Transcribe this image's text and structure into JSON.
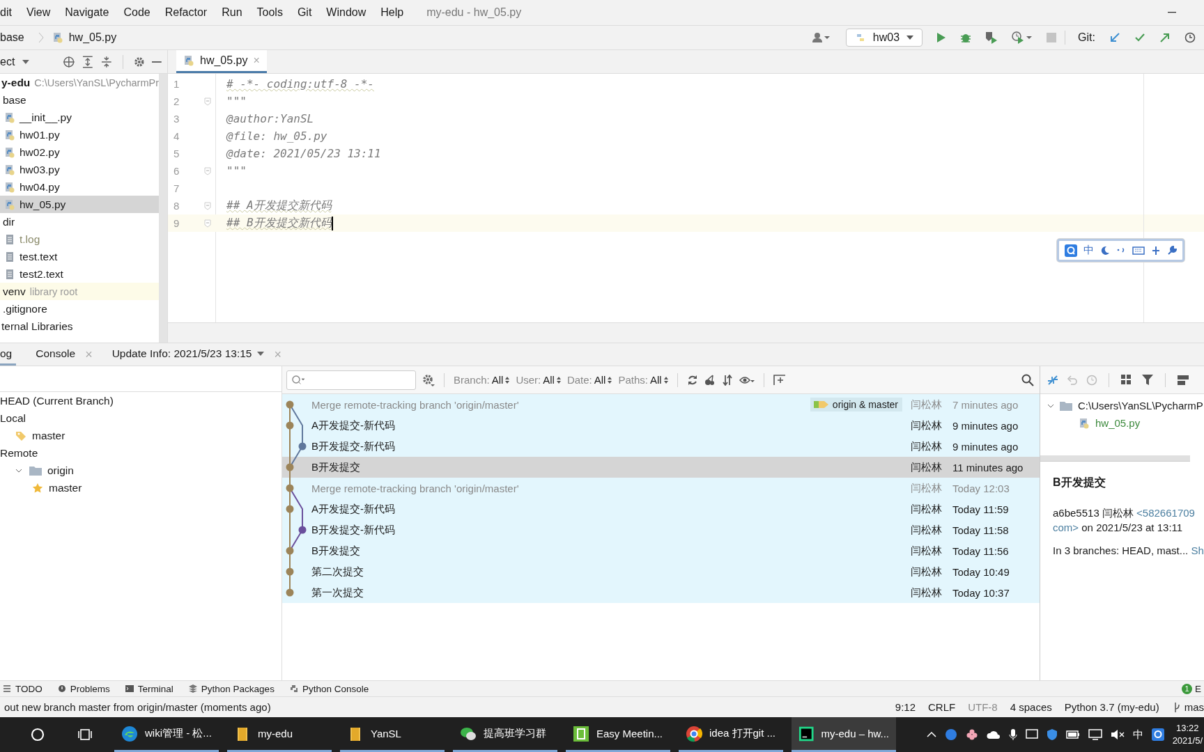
{
  "menu": [
    "dit",
    "View",
    "Navigate",
    "Code",
    "Refactor",
    "Run",
    "Tools",
    "Git",
    "Window",
    "Help"
  ],
  "window_title": "my-edu - hw_05.py",
  "breadcrumb": [
    "base",
    "hw_05.py"
  ],
  "toolbar": {
    "run_config": "hw03",
    "git_label": "Git:"
  },
  "project": {
    "header": "ect",
    "tree": [
      {
        "label": "y-edu",
        "hint": "C:\\Users\\YanSL\\PycharmPr",
        "kind": "root",
        "selected": false,
        "children": [
          {
            "label": "base",
            "kind": "folder",
            "selected": false,
            "children": [
              {
                "label": "__init__.py",
                "kind": "python",
                "selected": false
              },
              {
                "label": "hw01.py",
                "kind": "python",
                "selected": false
              },
              {
                "label": "hw02.py",
                "kind": "python",
                "selected": false
              },
              {
                "label": "hw03.py",
                "kind": "python",
                "selected": false
              },
              {
                "label": "hw04.py",
                "kind": "python",
                "selected": false
              },
              {
                "label": "hw_05.py",
                "kind": "python",
                "selected": true
              }
            ]
          },
          {
            "label": "dir",
            "kind": "folder",
            "selected": false,
            "children": [
              {
                "label": "t.log",
                "kind": "ignored",
                "selected": false
              },
              {
                "label": "test.text",
                "kind": "text",
                "selected": false
              },
              {
                "label": "test2.text",
                "kind": "text",
                "selected": false
              }
            ]
          },
          {
            "label": "venv",
            "hint": "library root",
            "kind": "library",
            "selected": false
          },
          {
            "label": ".gitignore",
            "kind": "folder",
            "selected": false
          }
        ]
      },
      {
        "label": "ternal Libraries",
        "kind": "root",
        "selected": false
      }
    ]
  },
  "editor": {
    "tab": {
      "label": "hw_05.py",
      "close": "×",
      "selected": true
    },
    "lines": [
      {
        "number": "1",
        "text": "# -*- coding:utf-8 -*-",
        "fold": false,
        "current": false
      },
      {
        "number": "2",
        "text": "\"\"\"",
        "fold": true,
        "current": false
      },
      {
        "number": "3",
        "text": "@author:YanSL",
        "fold": false,
        "current": false
      },
      {
        "number": "4",
        "text": "@file: hw_05.py",
        "fold": false,
        "current": false
      },
      {
        "number": "5",
        "text": "@date: 2021/05/23 13:11",
        "fold": false,
        "current": false
      },
      {
        "number": "6",
        "text": "\"\"\"",
        "fold": true,
        "current": false
      },
      {
        "number": "7",
        "fold": false,
        "current": false
      },
      {
        "number": "8",
        "text": "## A开发提交新代码",
        "fold": true,
        "current": false
      },
      {
        "number": "9",
        "text": "## B开发提交新代码",
        "fold": true,
        "current": true
      }
    ],
    "ime_mode": "中"
  },
  "bottom_tabs": [
    {
      "label": "og",
      "selected": true
    },
    {
      "label": "Console",
      "close": "×",
      "selected": false
    },
    {
      "label": "Update Info: 2021/5/23 13:15",
      "close": "×",
      "selected": false
    }
  ],
  "branches": [
    {
      "label": "HEAD (Current Branch)"
    },
    {
      "label": "Local",
      "children": [
        {
          "label": "master",
          "kind": "tag"
        }
      ]
    },
    {
      "label": "Remote",
      "children": [
        {
          "label": "origin",
          "kind": "folder",
          "children": [
            {
              "label": "master",
              "kind": "star"
            }
          ]
        }
      ]
    }
  ],
  "log_filters": [
    {
      "label": "Branch:",
      "value": "All"
    },
    {
      "label": "User:",
      "value": "All"
    },
    {
      "label": "Date:",
      "value": "All"
    },
    {
      "label": "Paths:",
      "value": "All"
    }
  ],
  "commits": [
    {
      "subject": "Merge remote-tracking branch 'origin/master'",
      "refs": "origin & master",
      "author": "闫松林",
      "date": "7 minutes ago",
      "kind": "main",
      "color": "#9c8459",
      "muted": true,
      "selected": false
    },
    {
      "subject": "A开发提交-新代码",
      "author": "闫松林",
      "date": "9 minutes ago",
      "kind": "main",
      "color": "#9c8459",
      "muted": false,
      "selected": false
    },
    {
      "subject": "B开发提交-新代码",
      "author": "闫松林",
      "date": "9 minutes ago",
      "kind": "branch",
      "color": "#60789c",
      "muted": false,
      "selected": false
    },
    {
      "subject": "B开发提交",
      "author": "闫松林",
      "date": "11 minutes ago",
      "kind": "main",
      "color": "#9c8459",
      "muted": false,
      "selected": true
    },
    {
      "subject": "Merge remote-tracking branch 'origin/master'",
      "author": "闫松林",
      "date": "Today 12:03",
      "kind": "main",
      "color": "#9c8459",
      "muted": true,
      "selected": false
    },
    {
      "subject": "A开发提交-新代码",
      "author": "闫松林",
      "date": "Today 11:59",
      "kind": "main",
      "color": "#9c8459",
      "muted": false,
      "selected": false
    },
    {
      "subject": "B开发提交-新代码",
      "author": "闫松林",
      "date": "Today 11:58",
      "kind": "branch",
      "color": "#6a4f9c",
      "muted": false,
      "selected": false
    },
    {
      "subject": "B开发提交",
      "author": "闫松林",
      "date": "Today 11:56",
      "kind": "main",
      "color": "#9c8459",
      "muted": false,
      "selected": false
    },
    {
      "subject": "第二次提交",
      "author": "闫松林",
      "date": "Today 10:49",
      "kind": "main",
      "color": "#9c8459",
      "muted": false,
      "selected": false
    },
    {
      "subject": "第一次提交",
      "author": "闫松林",
      "date": "Today 10:37",
      "kind": "main",
      "color": "#9c8459",
      "muted": false,
      "selected": false
    }
  ],
  "changes": {
    "folder": "C:\\Users\\YanSL\\PycharmP",
    "file": "hw_05.py"
  },
  "details": {
    "title": "B开发提交",
    "hash_author": "a6be5513 闫松林",
    "email_start": "<582661709",
    "email_end": "com>",
    "date_text": "on 2021/5/23 at 13:11",
    "branches_text": "In 3 branches: HEAD, mast...",
    "show_link": "Sh"
  },
  "tool_windows": [
    "TODO",
    "Problems",
    "Terminal",
    "Python Packages",
    "Python Console"
  ],
  "tool_window_right": {
    "badge": "1",
    "label": "E"
  },
  "status": {
    "message": "out new branch master from origin/master (moments ago)",
    "items": [
      {
        "text": "9:12",
        "muted": false
      },
      {
        "text": "CRLF",
        "muted": false
      },
      {
        "text": "UTF-8",
        "muted": true
      },
      {
        "text": "4 spaces",
        "muted": false
      },
      {
        "text": "Python 3.7 (my-edu)",
        "muted": false
      }
    ],
    "branch": "mas"
  },
  "taskbar": {
    "apps": [
      {
        "label": "wiki管理 - 松...",
        "kind": "edge",
        "selected": false
      },
      {
        "label": "my-edu",
        "kind": "folder",
        "selected": false
      },
      {
        "label": "YanSL",
        "kind": "folder",
        "selected": false
      },
      {
        "label": "提高班学习群",
        "kind": "wechat",
        "selected": false
      },
      {
        "label": "Easy Meetin...",
        "kind": "meeting",
        "selected": false
      },
      {
        "label": "idea 打开git ...",
        "kind": "chrome",
        "selected": false
      },
      {
        "label": "my-edu – hw...",
        "kind": "pycharm",
        "selected": true
      }
    ],
    "ime": "中",
    "time": "13:22",
    "date": "2021/5/"
  }
}
